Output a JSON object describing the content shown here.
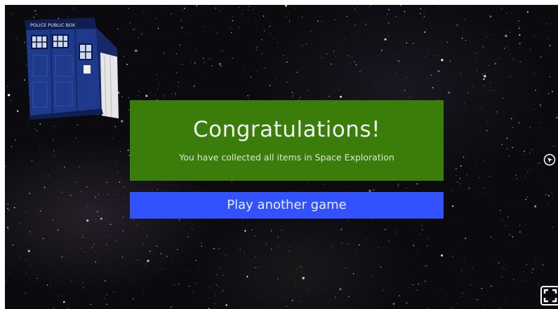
{
  "game": {
    "name": "Space Exploration"
  },
  "congrats": {
    "title": "Congratulations!",
    "subtitle": "You have collected all items in Space Exploration"
  },
  "actions": {
    "play_again_label": "Play another game"
  },
  "scene": {
    "tardis_sign": "POLICE PUBLIC BOX"
  },
  "icons": {
    "cursor": "cursor-icon",
    "fullscreen": "fullscreen-icon"
  },
  "colors": {
    "panel_green": "#3a7d0a",
    "button_blue": "#3352ff",
    "space_background": "#0b0b0f",
    "tardis_blue": "#1f3a8a"
  }
}
